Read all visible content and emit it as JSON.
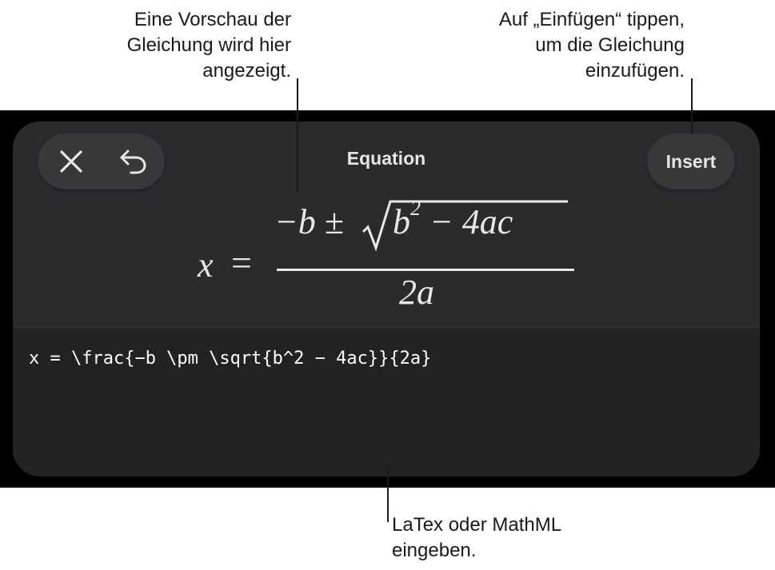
{
  "callouts": {
    "preview": [
      "Eine Vorschau der",
      "Gleichung wird hier",
      "angezeigt."
    ],
    "insert": [
      "Auf „Einfügen“ tippen,",
      "um die Gleichung",
      "einzufügen."
    ],
    "input": [
      "LaTex oder MathML",
      "eingeben."
    ]
  },
  "sheet": {
    "title": "Equation",
    "insert_label": "Insert"
  },
  "equation_preview": {
    "lhs": "x",
    "equals": "=",
    "numerator": "−b ±",
    "radicand_base": "b",
    "radicand_exponent": "2",
    "radicand_rest": " − 4ac",
    "denominator": "2a"
  },
  "latex_input": {
    "value": "x = \\frac{−b \\pm \\sqrt{b^2 − 4ac}}{2a}"
  },
  "icons": {
    "close": "close-icon",
    "undo": "undo-icon"
  },
  "colors": {
    "sheet_bg": "#2b2b2e",
    "input_bg": "#222224",
    "button_bg": "#38383b",
    "text": "#e6e6e6"
  }
}
